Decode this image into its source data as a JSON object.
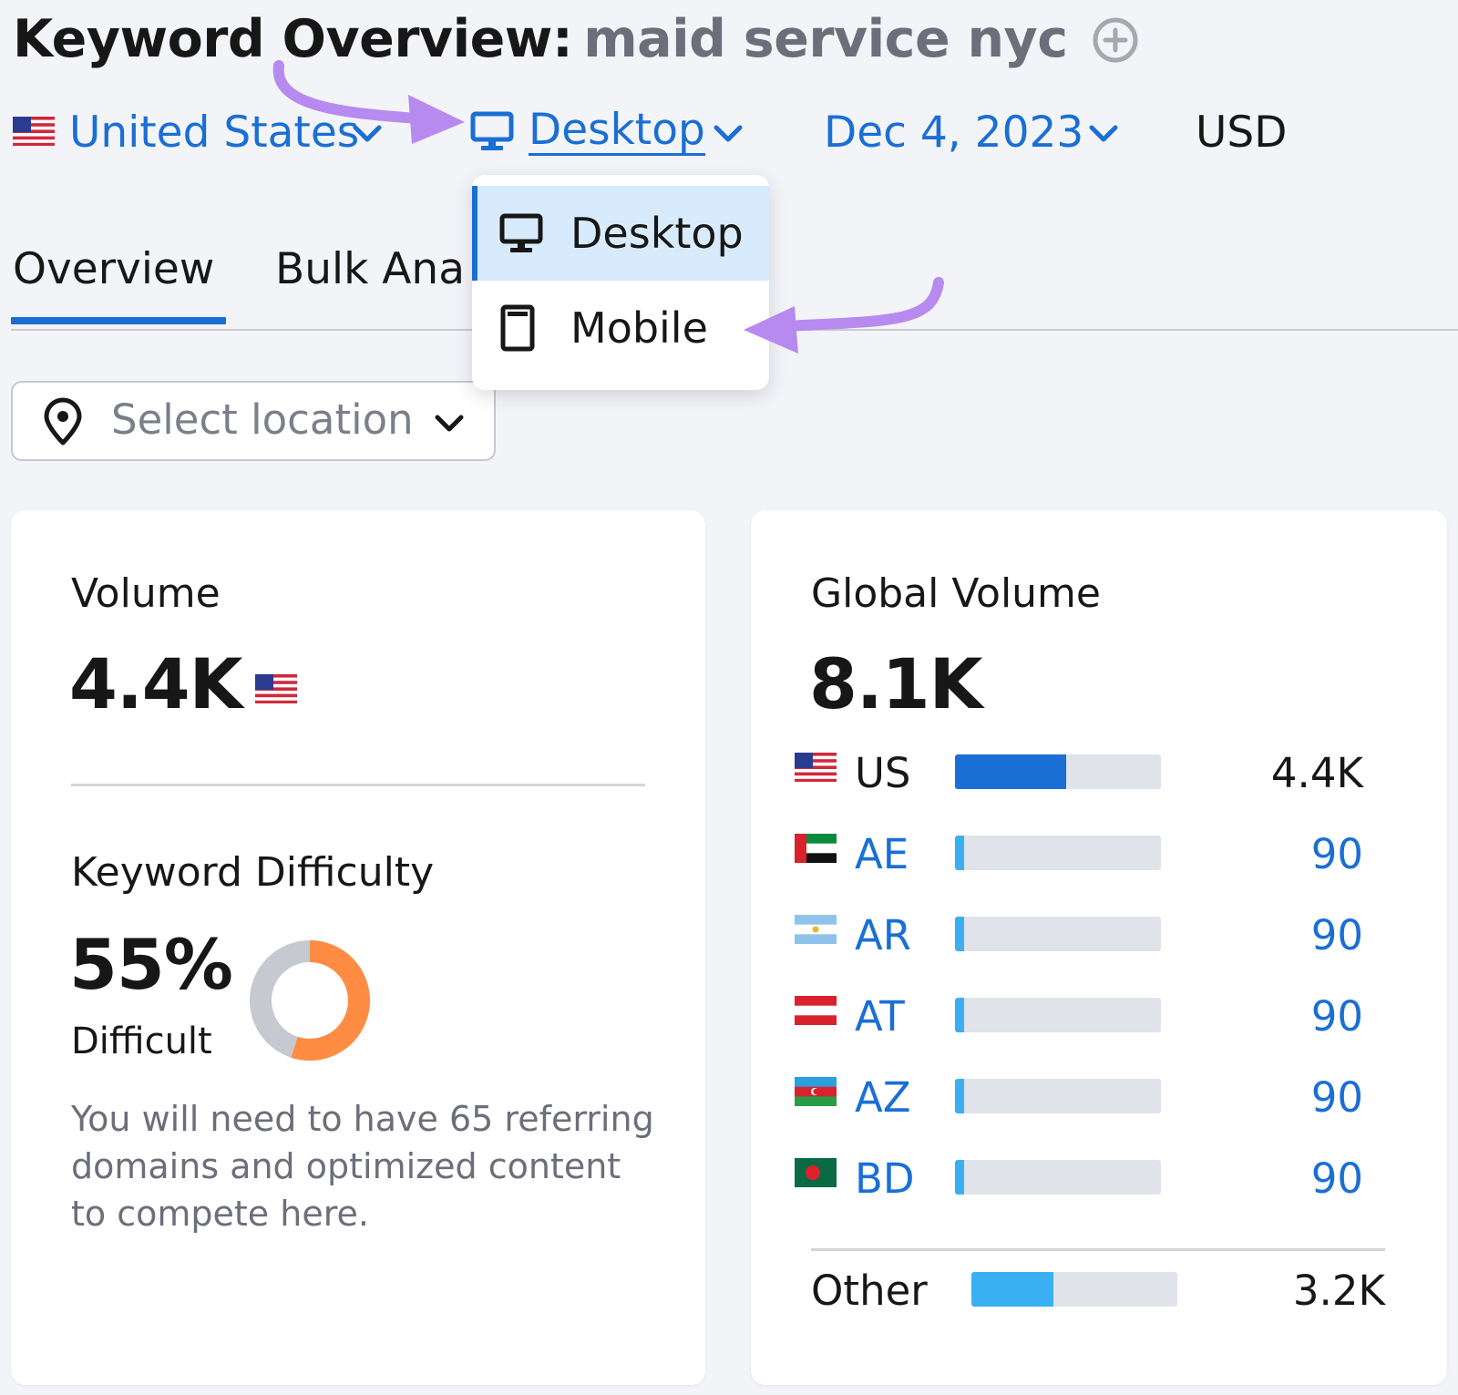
{
  "header": {
    "title_label": "Keyword Overview:",
    "keyword": "maid service nyc"
  },
  "filters": {
    "country": "United States",
    "device": "Desktop",
    "date": "Dec 4, 2023",
    "currency": "USD"
  },
  "device_dropdown": {
    "options": [
      {
        "label": "Desktop",
        "icon": "desktop-icon",
        "selected": true
      },
      {
        "label": "Mobile",
        "icon": "mobile-icon",
        "selected": false
      }
    ]
  },
  "tabs": [
    {
      "label": "Overview",
      "active": true
    },
    {
      "label": "Bulk Ana",
      "active": false
    }
  ],
  "location_select": {
    "placeholder": "Select location"
  },
  "volume_card": {
    "label": "Volume",
    "value": "4.4K",
    "difficulty_label": "Keyword Difficulty",
    "difficulty_value": "55%",
    "difficulty_level": "Difficult",
    "difficulty_fraction": 0.55,
    "description": "You will need to have 65 referring domains and optimized content to compete here."
  },
  "global_card": {
    "label": "Global Volume",
    "value": "8.1K",
    "rows": [
      {
        "code": "US",
        "value": "4.4K",
        "fraction": 0.54,
        "highlight": false
      },
      {
        "code": "AE",
        "value": "90",
        "fraction": 0.045,
        "highlight": true
      },
      {
        "code": "AR",
        "value": "90",
        "fraction": 0.045,
        "highlight": true
      },
      {
        "code": "AT",
        "value": "90",
        "fraction": 0.045,
        "highlight": true
      },
      {
        "code": "AZ",
        "value": "90",
        "fraction": 0.045,
        "highlight": true
      },
      {
        "code": "BD",
        "value": "90",
        "fraction": 0.045,
        "highlight": true
      }
    ],
    "other": {
      "label": "Other",
      "value": "3.2K",
      "fraction": 0.4
    }
  },
  "colors": {
    "accent": "#1a6fd4",
    "bar_primary": "#1a6fd4",
    "bar_secondary": "#3ab0f2",
    "difficulty": "#ff8c42",
    "annotation_arrow": "#b78af0"
  }
}
